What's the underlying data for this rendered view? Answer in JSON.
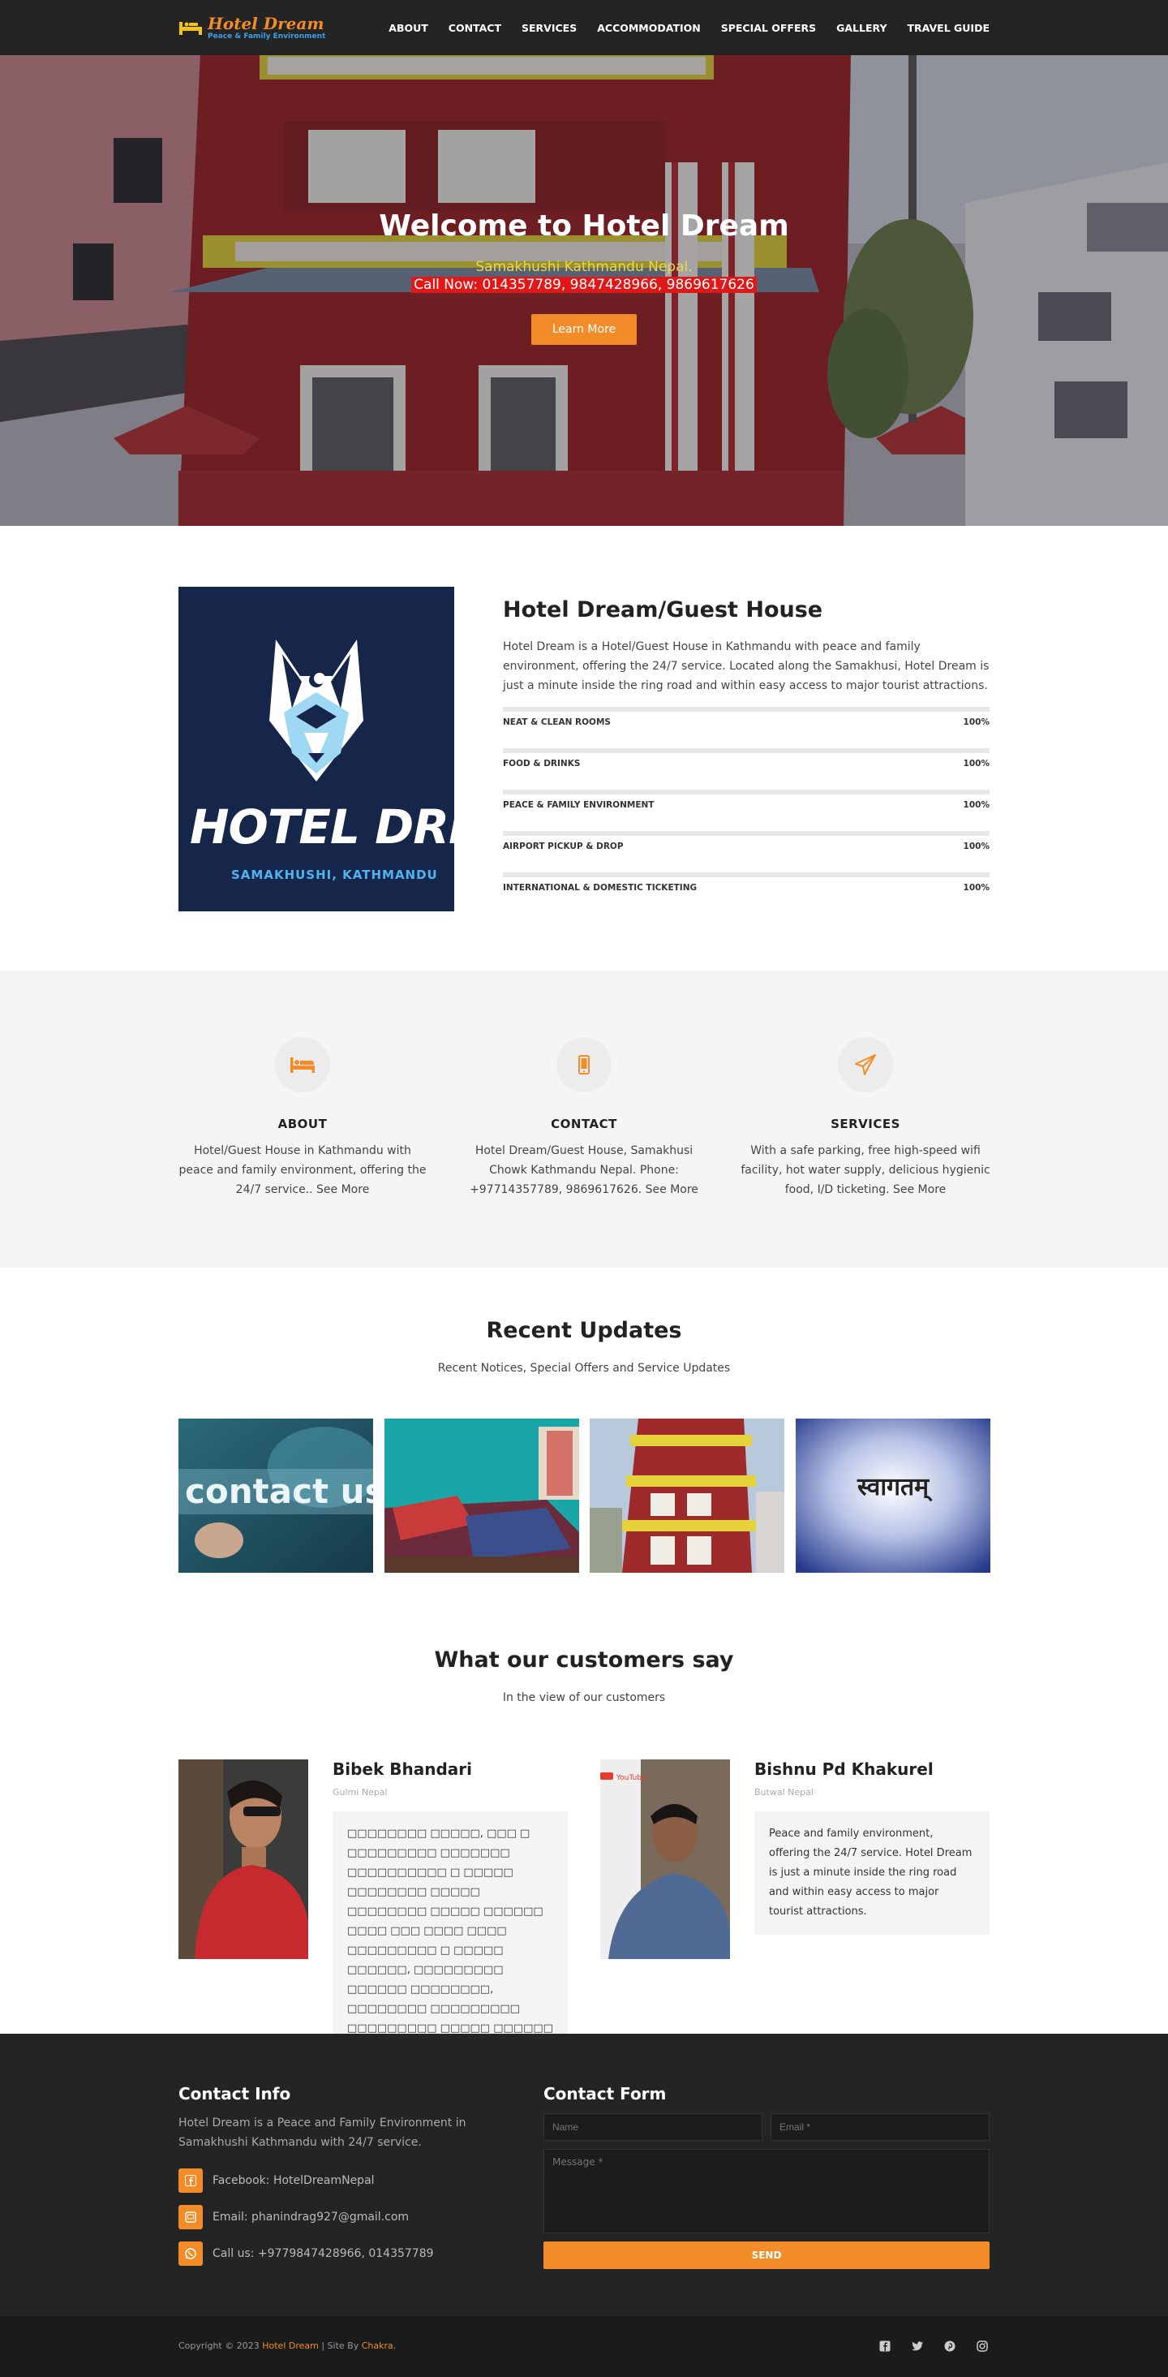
{
  "brand": {
    "name": "Hotel Dream",
    "tagline": "Peace & Family Environment"
  },
  "nav": [
    {
      "label": "ABOUT"
    },
    {
      "label": "CONTACT"
    },
    {
      "label": "SERVICES"
    },
    {
      "label": "ACCOMMODATION"
    },
    {
      "label": "SPECIAL OFFERS"
    },
    {
      "label": "GALLERY"
    },
    {
      "label": "TRAVEL GUIDE"
    }
  ],
  "hero": {
    "title": "Welcome to Hotel Dream",
    "subtitle": "Samakhushi Kathmandu Nepal.",
    "call": "Call Now: 014357789, 9847428966, 9869617626",
    "button": "Learn More"
  },
  "about": {
    "image_brand": "HOTEL DREAM",
    "image_location": "SAMAKHUSHI, KATHMANDU",
    "title": "Hotel Dream/Guest House",
    "description": "Hotel Dream is a Hotel/Guest House in Kathmandu with peace and family environment, offering the 24/7 service. Located along the Samakhusi, Hotel Dream is just a minute inside the ring road and within easy access to major tourist attractions.",
    "skills": [
      {
        "label": "NEAT & CLEAN ROOMS",
        "percent": "100%",
        "value": 100
      },
      {
        "label": "FOOD & DRINKS",
        "percent": "100%",
        "value": 100
      },
      {
        "label": "PEACE & FAMILY ENVIRONMENT",
        "percent": "100%",
        "value": 100
      },
      {
        "label": "AIRPORT PICKUP & DROP",
        "percent": "100%",
        "value": 100
      },
      {
        "label": "INTERNATIONAL & DOMESTIC TICKETING",
        "percent": "100%",
        "value": 100
      }
    ]
  },
  "features": [
    {
      "title": "ABOUT",
      "icon": "bed-icon",
      "desc": "Hotel/Guest House in Kathmandu with peace and family environment, offering the 24/7 service.. See More"
    },
    {
      "title": "CONTACT",
      "icon": "mobile-icon",
      "desc": "Hotel Dream/Guest House, Samakhusi Chowk Kathmandu Nepal. Phone: +97714357789, 9869617626. See More"
    },
    {
      "title": "SERVICES",
      "icon": "paper-plane-icon",
      "desc": "With a safe parking, free high-speed wifi facility, hot water supply, delicious hygienic food, I/D ticketing. See More"
    }
  ],
  "updates": {
    "title": "Recent Updates",
    "subtitle": "Recent Notices, Special Offers and Service Updates",
    "thumb1_text": "contact us",
    "thumb4_text": "स्वागतम्"
  },
  "testimonials": {
    "title": "What our customers say",
    "subtitle": "In the view of our customers",
    "items": [
      {
        "name": "Bibek Bhandari",
        "location": "Gulmi Nepal",
        "quote": "□□□□□□□□ □□□□□, □□□ □ □□□□□□□□□ □□□□□□□ □□□□□□□□□□ □ □□□□□ □□□□□□□□ □□□□□ □□□□□□□□ □□□□□ □□□□□□ □□□□ □□□ □□□□ □□□□ □□□□□□□□□ □ □□□□□ □□□□□□, □□□□□□□□□ □□□□□□ □□□□□□□□, □□□□□□□□ □□□□□□□□□ □□□□□□□□□ □□□□□ □□□□□□ □ □□□□□□ □"
      },
      {
        "name": "Bishnu Pd Khakurel",
        "location": "Butwal Nepal",
        "quote": "Peace and family environment, offering the 24/7 service. Hotel Dream is just a minute inside the ring road and within easy access to major tourist attractions.",
        "badge": "YouTube"
      }
    ]
  },
  "footer": {
    "contact_title": "Contact Info",
    "contact_desc": "Hotel Dream is a Peace and Family Environment in Samakhushi Kathmandu with 24/7 service.",
    "facebook": "Facebook: HotelDreamNepal",
    "email": "Email: phanindrag927@gmail.com",
    "phone": "Call us: +9779847428966, 014357789",
    "form_title": "Contact Form",
    "name_placeholder": "Name",
    "email_placeholder": "Email *",
    "message_placeholder": "Message *",
    "send": "SEND"
  },
  "bottom": {
    "copy_prefix": "Copyright © 2023 ",
    "copy_brand": "Hotel Dream",
    "copy_mid": " | Site By ",
    "copy_site": "Chakra."
  },
  "colors": {
    "accent": "#f28c28",
    "dark": "#242424",
    "footer_bottom": "#1b1b1b"
  }
}
